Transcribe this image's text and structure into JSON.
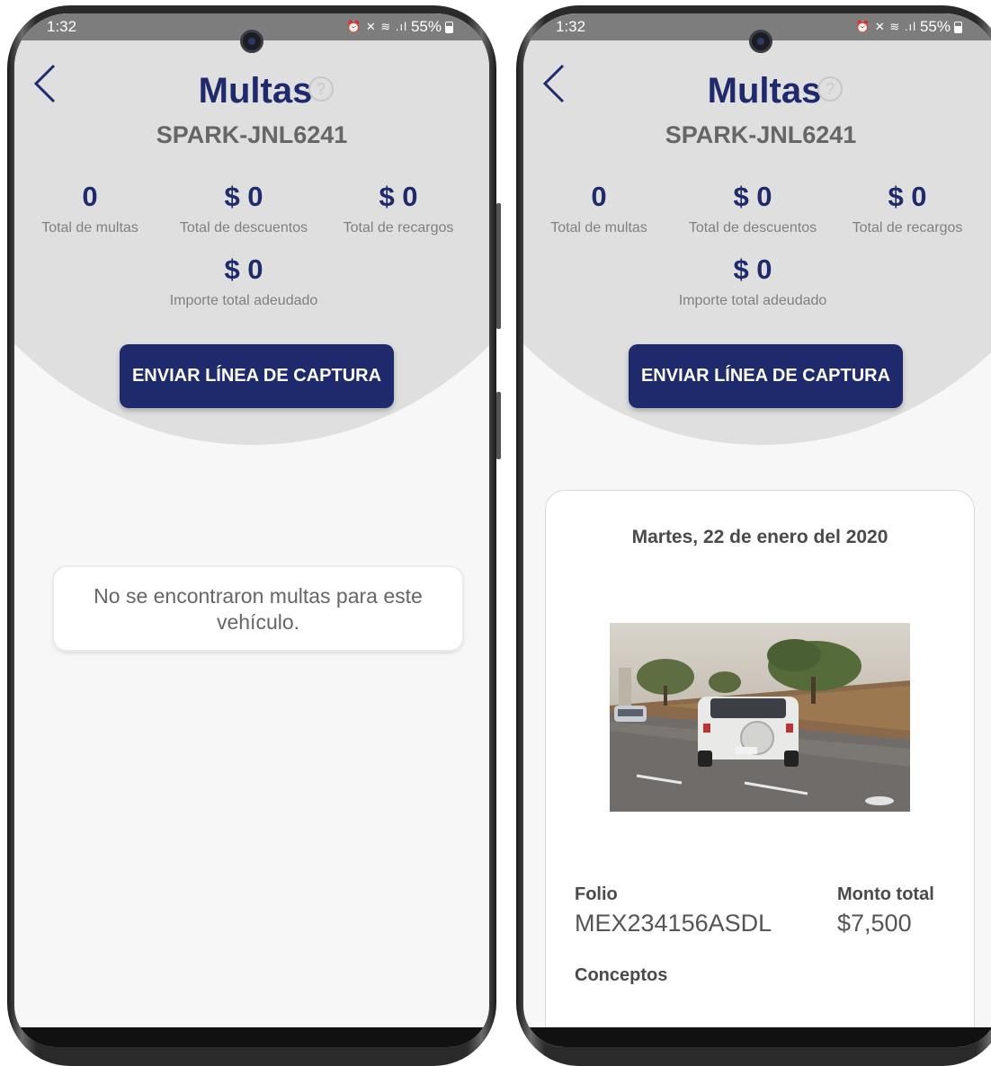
{
  "status_bar": {
    "time": "1:32",
    "battery": "55%",
    "icons": "⏰ ✕ ≋ .ıl"
  },
  "header": {
    "title": "Multas",
    "help_icon": "?",
    "plate": "SPARK-JNL6241"
  },
  "summary": {
    "total_fines": {
      "value": "0",
      "label": "Total de multas"
    },
    "total_discounts": {
      "value": "$ 0",
      "label": "Total de descuentos"
    },
    "total_surcharges": {
      "value": "$ 0",
      "label": "Total de recargos"
    },
    "total_owed": {
      "value": "$ 0",
      "label": "Importe total adeudado"
    }
  },
  "cta": {
    "label": "ENVIAR LÍNEA DE CAPTURA"
  },
  "empty_state": {
    "message": "No se encontraron multas para este vehículo."
  },
  "fine": {
    "date": "Martes, 22 de enero del 2020",
    "folio_label": "Folio",
    "folio_value": "MEX234156ASDL",
    "amount_label": "Monto total",
    "amount_value": "$7,500",
    "concepts_label": "Conceptos"
  },
  "icons": {
    "back": "chevron-left-icon",
    "help": "question-circle-icon",
    "alarm": "alarm-icon",
    "mute": "mute-icon",
    "wifi": "wifi-icon",
    "signal": "signal-icon",
    "battery": "battery-icon"
  },
  "colors": {
    "primary_navy": "#1f2a6d",
    "header_gray": "#e0dfdf",
    "status_bar": "#7d7d7d",
    "label_gray": "#808080"
  }
}
